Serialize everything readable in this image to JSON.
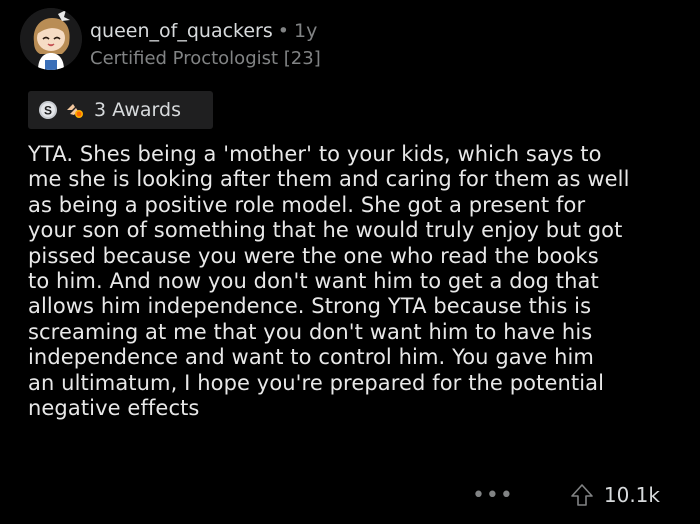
{
  "comment": {
    "author": "queen_of_quackers",
    "separator": "•",
    "age": "1y",
    "flair": "Certified Proctologist [23]",
    "awards_label": "3 Awards",
    "body": "YTA. Shes being a 'mother' to your kids, which says to\nme she is looking after them and caring for them as well\nas being a positive role model. She got a present for\nyour son of something that he would truly enjoy but got\npissed because you were the one who read the books\nto him. And now you don't want him to get a dog that\nallows him independence. Strong YTA because this is\nscreaming at me that you don't want him to have his\nindependence and want to control him. You gave him\nan ultimatum, I hope you're prepared for the potential\nnegative effects",
    "more_label": "•••",
    "score": "10.1k"
  },
  "icons": {
    "avatar": "avatar-icon",
    "award_1": "silver-award-icon",
    "award_2": "wholesome-award-icon",
    "upvote": "upvote-arrow-icon"
  },
  "colors": {
    "background": "#000000",
    "text": "#d7dadc",
    "muted": "#818384",
    "award_bg": "#1f1f20"
  }
}
